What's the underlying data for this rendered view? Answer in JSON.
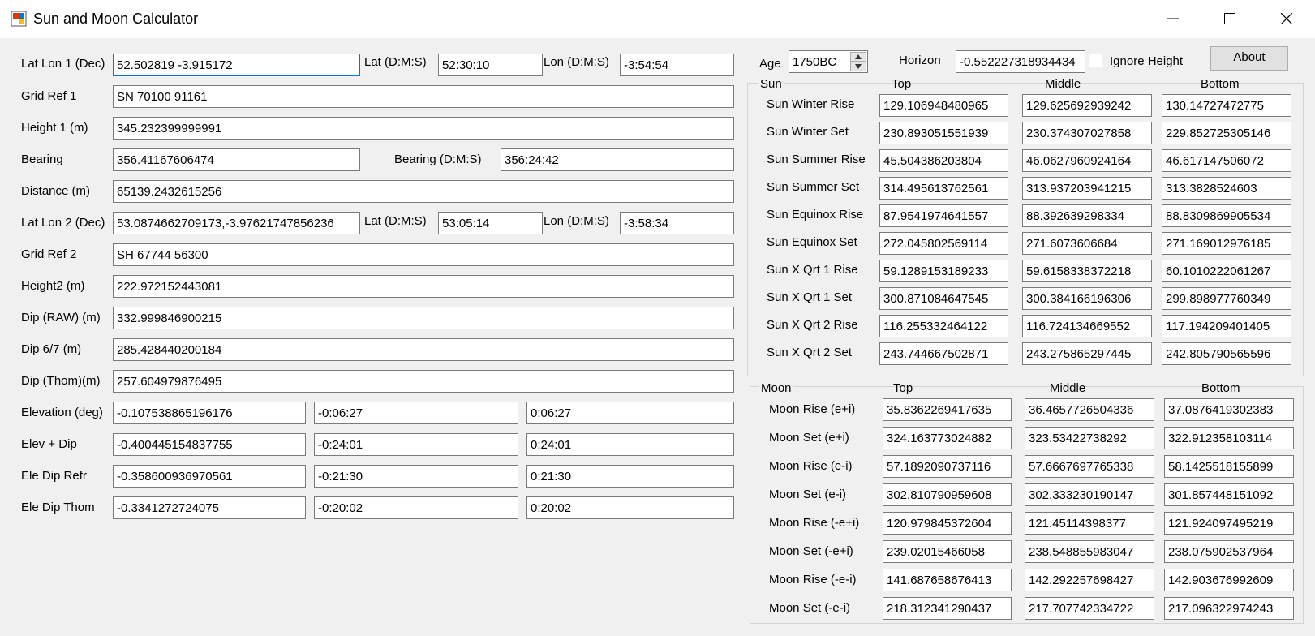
{
  "window": {
    "title": "Sun and Moon Calculator"
  },
  "left": {
    "lat_lon_1_label": "Lat Lon 1 (Dec)",
    "lat_lon_1": "52.502819 -3.915172",
    "lat_dms_label_1": "Lat (D:M:S)",
    "lat_dms_1": "52:30:10",
    "lon_dms_label_1": "Lon (D:M:S)",
    "lon_dms_1": "-3:54:54",
    "grid_ref_1_label": "Grid Ref 1",
    "grid_ref_1": "SN 70100 91161",
    "height_1_label": "Height 1 (m)",
    "height_1": "345.232399999991",
    "bearing_label": "Bearing",
    "bearing": "356.41167606474",
    "bearing_dms_label": "Bearing (D:M:S)",
    "bearing_dms": "356:24:42",
    "distance_label": "Distance (m)",
    "distance": "65139.2432615256",
    "lat_lon_2_label": "Lat Lon 2 (Dec)",
    "lat_lon_2": "53.0874662709173,-3.97621747856236",
    "lat_dms_label_2": "Lat (D:M:S)",
    "lat_dms_2": "53:05:14",
    "lon_dms_label_2": "Lon (D:M:S)",
    "lon_dms_2": "-3:58:34",
    "grid_ref_2_label": "Grid Ref 2",
    "grid_ref_2": "SH 67744 56300",
    "height_2_label": "Height2 (m)",
    "height_2": "222.972152443081",
    "dip_raw_label": "Dip (RAW) (m)",
    "dip_raw": "332.999846900215",
    "dip_67_label": "Dip 6/7 (m)",
    "dip_67": "285.428440200184",
    "dip_thom_label": "Dip (Thom)(m)",
    "dip_thom": "257.604979876495",
    "elev_rows": [
      {
        "label": "Elevation (deg)",
        "v1": "-0.107538865196176",
        "v2": "-0:06:27",
        "v3": "0:06:27"
      },
      {
        "label": "Elev + Dip",
        "v1": "-0.400445154837755",
        "v2": "-0:24:01",
        "v3": "0:24:01"
      },
      {
        "label": "Ele Dip Refr",
        "v1": "-0.358600936970561",
        "v2": "-0:21:30",
        "v3": "0:21:30"
      },
      {
        "label": "Ele Dip Thom",
        "v1": "-0.3341272724075",
        "v2": "-0:20:02",
        "v3": "0:20:02"
      }
    ]
  },
  "top": {
    "age_label": "Age",
    "age": "1750BC",
    "horizon_label": "Horizon",
    "horizon": "-0.552227318934434",
    "ignore_height_label": "Ignore Height",
    "about_label": "About"
  },
  "sun": {
    "title": "Sun",
    "col_top": "Top",
    "col_middle": "Middle",
    "col_bottom": "Bottom",
    "rows": [
      {
        "label": "Sun Winter Rise",
        "top": "129.106948480965",
        "middle": "129.625692939242",
        "bottom": "130.14727472775"
      },
      {
        "label": "Sun Winter Set",
        "top": "230.893051551939",
        "middle": "230.374307027858",
        "bottom": "229.852725305146"
      },
      {
        "label": "Sun Summer Rise",
        "top": "45.504386203804",
        "middle": "46.0627960924164",
        "bottom": "46.617147506072"
      },
      {
        "label": "Sun Summer Set",
        "top": "314.495613762561",
        "middle": "313.937203941215",
        "bottom": "313.3828524603"
      },
      {
        "label": "Sun Equinox Rise",
        "top": "87.9541974641557",
        "middle": "88.392639298334",
        "bottom": "88.8309869905534"
      },
      {
        "label": "Sun Equinox Set",
        "top": "272.045802569114",
        "middle": "271.6073606684",
        "bottom": "271.169012976185"
      },
      {
        "label": "Sun X Qrt 1 Rise",
        "top": "59.1289153189233",
        "middle": "59.6158338372218",
        "bottom": "60.1010222061267"
      },
      {
        "label": "Sun X Qrt 1 Set",
        "top": "300.871084647545",
        "middle": "300.384166196306",
        "bottom": "299.898977760349"
      },
      {
        "label": "Sun X Qrt 2 Rise",
        "top": "116.255332464122",
        "middle": "116.724134669552",
        "bottom": "117.194209401405"
      },
      {
        "label": "Sun X Qrt 2 Set",
        "top": "243.744667502871",
        "middle": "243.275865297445",
        "bottom": "242.805790565596"
      }
    ]
  },
  "moon": {
    "title": "Moon",
    "col_top": "Top",
    "col_middle": "Middle",
    "col_bottom": "Bottom",
    "rows": [
      {
        "label": "Moon Rise (e+i)",
        "top": "35.8362269417635",
        "middle": "36.4657726504336",
        "bottom": "37.0876419302383"
      },
      {
        "label": "Moon Set (e+i)",
        "top": "324.163773024882",
        "middle": "323.53422738292",
        "bottom": "322.912358103114"
      },
      {
        "label": "Moon Rise (e-i)",
        "top": "57.1892090737116",
        "middle": "57.6667697765338",
        "bottom": "58.1425518155899"
      },
      {
        "label": "Moon Set (e-i)",
        "top": "302.810790959608",
        "middle": "302.333230190147",
        "bottom": "301.857448151092"
      },
      {
        "label": "Moon Rise (-e+i)",
        "top": "120.979845372604",
        "middle": "121.45114398377",
        "bottom": "121.924097495219"
      },
      {
        "label": "Moon Set (-e+i)",
        "top": "239.02015466058",
        "middle": "238.548855983047",
        "bottom": "238.075902537964"
      },
      {
        "label": "Moon Rise (-e-i)",
        "top": "141.687658676413",
        "middle": "142.292257698427",
        "bottom": "142.903676992609"
      },
      {
        "label": "Moon Set (-e-i)",
        "top": "218.312341290437",
        "middle": "217.707742334722",
        "bottom": "217.096322974243"
      }
    ]
  }
}
